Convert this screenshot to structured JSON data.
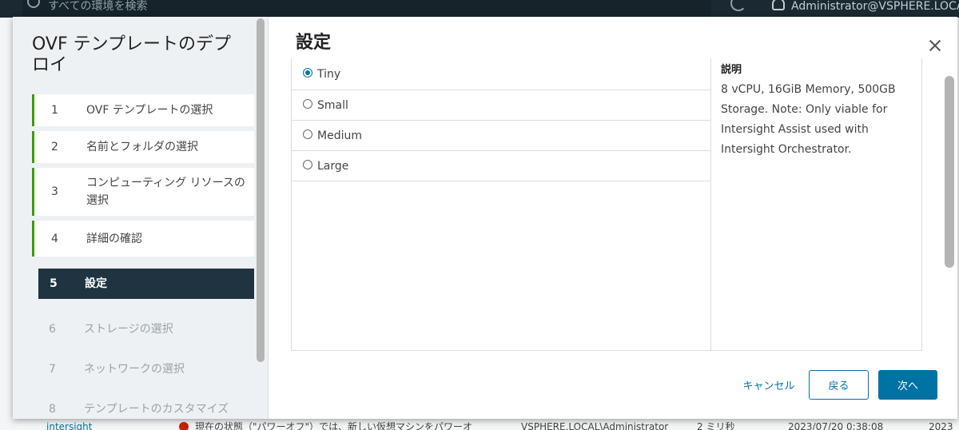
{
  "background": {
    "search_placeholder": "すべての環境を検索",
    "user": "Administrator@VSPHERE.LOCAL",
    "bottom_row": {
      "name": "intersight",
      "message": "現在の状態（\"パワーオフ\"）では、新しい仮想マシンをパワーオ",
      "initiator": "VSPHERE.LOCAL\\Administrator",
      "queued": "2 ミリ秒",
      "start": "2023/07/20 0:38:08",
      "end": "2023"
    }
  },
  "wizard": {
    "title": "OVF テンプレートのデプロイ",
    "steps": [
      {
        "num": "1",
        "label": "OVF テンプレートの選択",
        "state": "done"
      },
      {
        "num": "2",
        "label": "名前とフォルダの選択",
        "state": "done"
      },
      {
        "num": "3",
        "label": "コンピューティング リソースの選択",
        "state": "done"
      },
      {
        "num": "4",
        "label": "詳細の確認",
        "state": "done"
      },
      {
        "num": "5",
        "label": "設定",
        "state": "active"
      },
      {
        "num": "6",
        "label": "ストレージの選択",
        "state": "future"
      },
      {
        "num": "7",
        "label": "ネットワークの選択",
        "state": "future"
      },
      {
        "num": "8",
        "label": "テンプレートのカスタマイズ",
        "state": "future"
      }
    ]
  },
  "content": {
    "title": "設定",
    "options": [
      {
        "label": "Tiny",
        "checked": true
      },
      {
        "label": "Small",
        "checked": false
      },
      {
        "label": "Medium",
        "checked": false
      },
      {
        "label": "Large",
        "checked": false
      }
    ],
    "description_heading": "説明",
    "description_text": "8 vCPU, 16GiB Memory, 500GB Storage. Note: Only viable for Intersight Assist used with Intersight Orchestrator."
  },
  "footer": {
    "cancel": "キャンセル",
    "back": "戻る",
    "next": "次へ"
  },
  "colors": {
    "accent": "#0072a3",
    "active_step_bg": "#1f3440",
    "done_marker": "#3c9c00"
  }
}
